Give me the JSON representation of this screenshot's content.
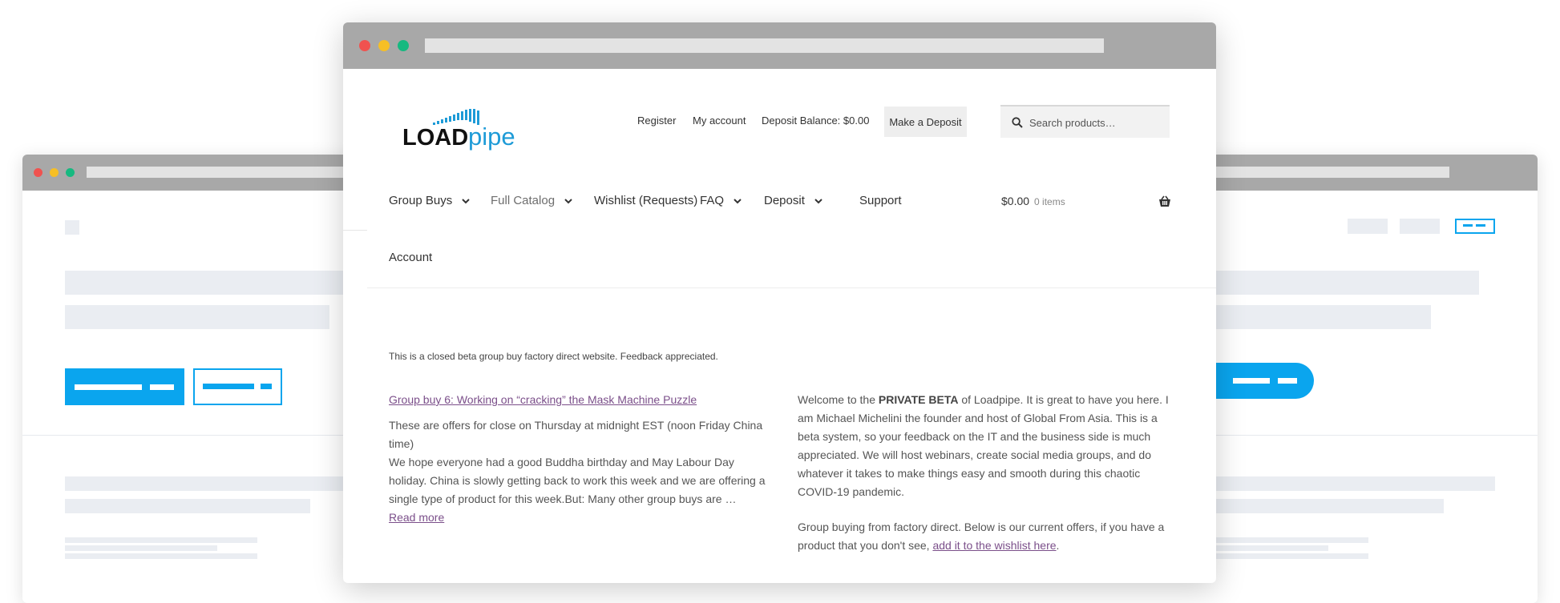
{
  "window_controls": {
    "close_color": "#f0524f",
    "minimize_color": "#f6bf26",
    "maximize_color": "#16b980"
  },
  "site": {
    "logo": {
      "text_bold": "LOAD",
      "text_light": "pipe",
      "dark_color": "#111111",
      "accent_color": "#1e9bd7"
    },
    "top_links": {
      "register": "Register",
      "my_account": "My account",
      "deposit_balance": "Deposit Balance: $0.00",
      "make_deposit": "Make a Deposit"
    },
    "search": {
      "placeholder": "Search products…"
    },
    "nav": {
      "group_buys": "Group Buys",
      "full_catalog": "Full Catalog",
      "wishlist": "Wishlist (Requests)",
      "faq": "FAQ",
      "deposit": "Deposit",
      "support": "Support",
      "account": "Account"
    },
    "cart": {
      "total": "$0.00",
      "items": "0 items"
    },
    "notice": "This is a closed beta group buy factory direct website. Feedback appreciated.",
    "post": {
      "title": "Group buy 6: Working on “cracking” the Mask Machine Puzzle",
      "para1": "These are offers for close on Thursday at midnight EST (noon Friday China time)",
      "para2": "We hope everyone had a good Buddha birthday and May Labour Day holiday. China is slowly getting back to work this week and we are offering a single type of product for this week.But: Many other group buys are … ",
      "read_more": "Read more"
    },
    "intro": {
      "welcome_prefix": "Welcome to the ",
      "private_beta": "PRIVATE BETA",
      "welcome_suffix": " of Loadpipe. It is great to have you here. I am Michael Michelini the founder and host of Global From Asia. This is a beta system, so your feedback on the IT and the business side is much appreciated. We will host webinars, create social media groups, and do whatever it takes to make things easy and smooth during this chaotic COVID-19 pandemic.",
      "offers_text": "Group buying from factory direct. Below is our current offers, if you have a product that you don't see, ",
      "wishlist_link": "add it to the wishlist here",
      "offers_end": "."
    }
  }
}
